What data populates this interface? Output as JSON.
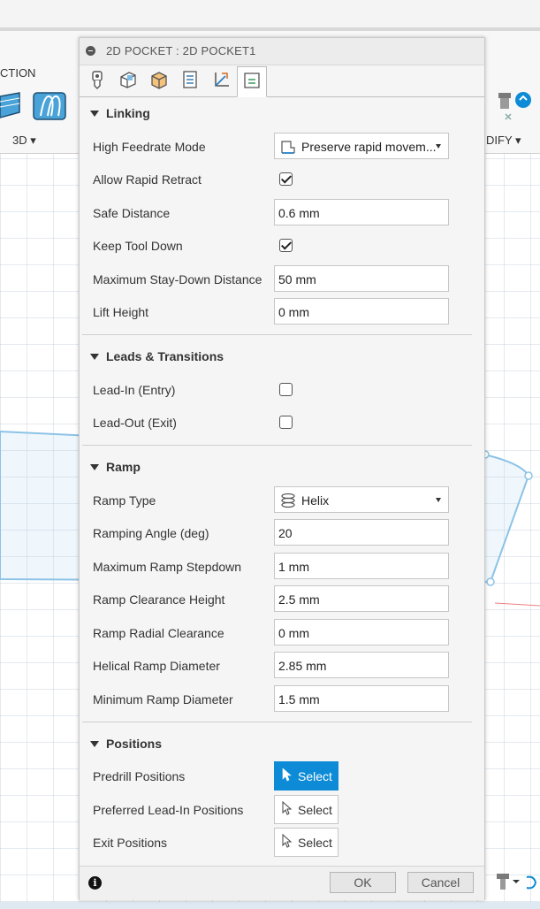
{
  "background": {
    "ribbon_left_label": "CTION",
    "ribbon_3d_label": "3D",
    "ribbon_modify_label": "DIFY"
  },
  "dialog": {
    "title": "2D POCKET : 2D POCKET1",
    "tabs": [
      {
        "icon": "tool-icon"
      },
      {
        "icon": "geometry-icon"
      },
      {
        "icon": "heights-icon"
      },
      {
        "icon": "passes-icon"
      },
      {
        "icon": "axis-icon"
      },
      {
        "icon": "linking-icon",
        "active": true
      }
    ],
    "sections": {
      "linking": {
        "title": "Linking",
        "high_feedrate_mode_label": "High Feedrate Mode",
        "high_feedrate_mode_value": "Preserve rapid movem...",
        "allow_rapid_retract_label": "Allow Rapid Retract",
        "allow_rapid_retract_checked": true,
        "safe_distance_label": "Safe Distance",
        "safe_distance_value": "0.6 mm",
        "keep_tool_down_label": "Keep Tool Down",
        "keep_tool_down_checked": true,
        "max_stay_down_label": "Maximum Stay-Down Distance",
        "max_stay_down_value": "50 mm",
        "lift_height_label": "Lift Height",
        "lift_height_value": "0 mm"
      },
      "leads": {
        "title": "Leads & Transitions",
        "lead_in_label": "Lead-In (Entry)",
        "lead_in_checked": false,
        "lead_out_label": "Lead-Out (Exit)",
        "lead_out_checked": false
      },
      "ramp": {
        "title": "Ramp",
        "ramp_type_label": "Ramp Type",
        "ramp_type_value": "Helix",
        "ramping_angle_label": "Ramping Angle (deg)",
        "ramping_angle_value": "20",
        "max_ramp_stepdown_label": "Maximum Ramp Stepdown",
        "max_ramp_stepdown_value": "1 mm",
        "ramp_clearance_height_label": "Ramp Clearance Height",
        "ramp_clearance_height_value": "2.5 mm",
        "ramp_radial_clearance_label": "Ramp Radial Clearance",
        "ramp_radial_clearance_value": "0 mm",
        "helical_ramp_diameter_label": "Helical Ramp Diameter",
        "helical_ramp_diameter_value": "2.85 mm",
        "min_ramp_diameter_label": "Minimum Ramp Diameter",
        "min_ramp_diameter_value": "1.5 mm"
      },
      "positions": {
        "title": "Positions",
        "predrill_label": "Predrill Positions",
        "preferred_lead_in_label": "Preferred Lead-In Positions",
        "exit_label": "Exit Positions",
        "select_label": "Select"
      }
    },
    "footer": {
      "ok_label": "OK",
      "cancel_label": "Cancel"
    }
  },
  "colors": {
    "accent": "#0d8bd6",
    "sketch_line": "#8cc3e6"
  }
}
